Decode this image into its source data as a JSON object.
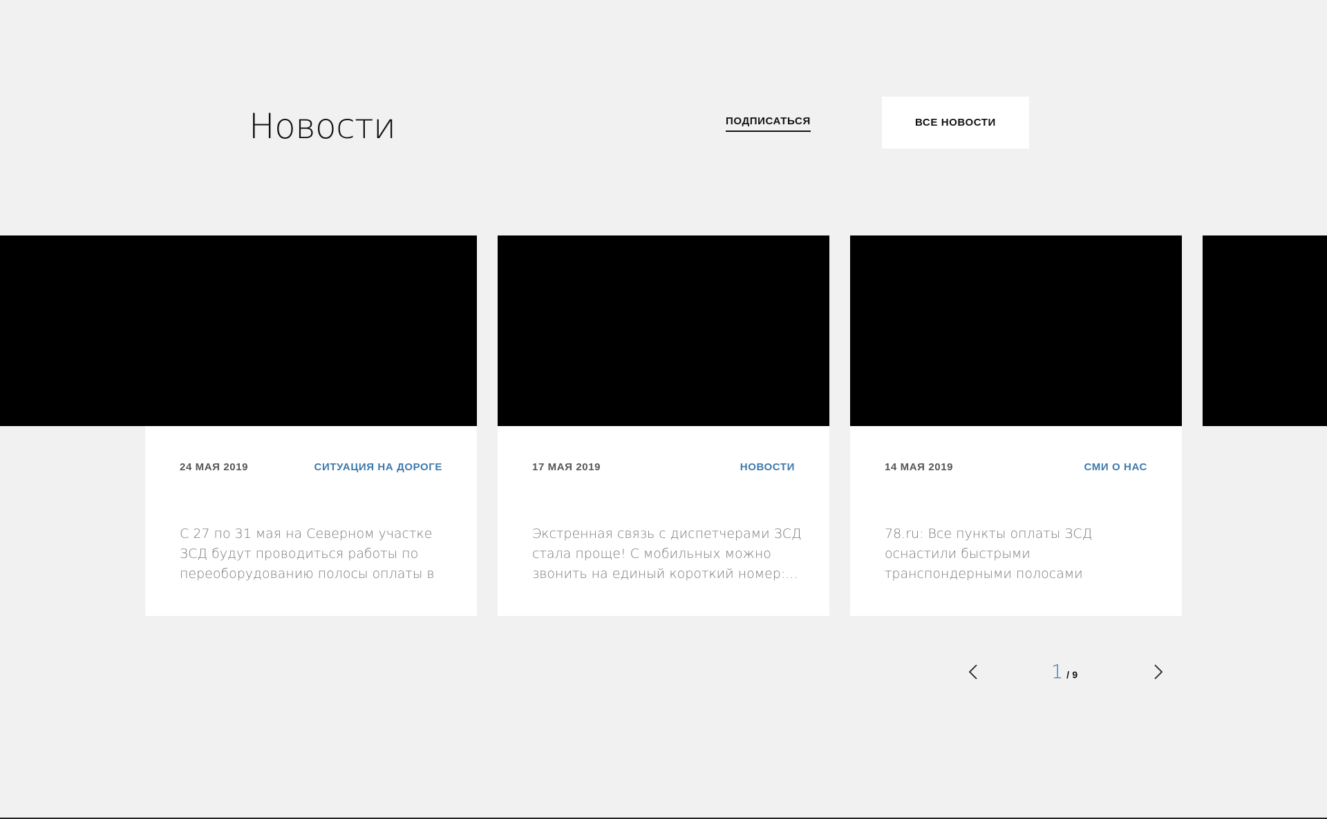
{
  "header": {
    "title": "Новости",
    "subscribe_label": "ПОДПИСАТЬСЯ",
    "all_news_label": "ВСЕ НОВОСТИ"
  },
  "cards": [
    {
      "date": "24 МАЯ 2019",
      "category": "СИТУАЦИЯ НА ДОРОГЕ",
      "excerpt": "С 27 по 31 мая на Северном участке ЗСД будут проводиться работы по переоборудованию полосы оплаты в ..."
    },
    {
      "date": "17 МАЯ 2019",
      "category": "НОВОСТИ",
      "excerpt": "Экстренная связь с диспетчерами ЗСД стала проще! С мобильных можно звонить на единый короткий номер:..."
    },
    {
      "date": "14 МАЯ 2019",
      "category": "СМИ О НАС",
      "excerpt": "78.ru: Все пункты оплаты ЗСД оснастили быстрыми транспондерными полосами"
    }
  ],
  "pager": {
    "current": "1",
    "separator": "/",
    "total": "9"
  },
  "colors": {
    "background": "#f1f1f1",
    "accent": "#3e79ad",
    "card": "#ffffff",
    "image_placeholder": "#000000"
  },
  "icons": {
    "prev": "chevron-left-icon",
    "next": "chevron-right-icon"
  }
}
